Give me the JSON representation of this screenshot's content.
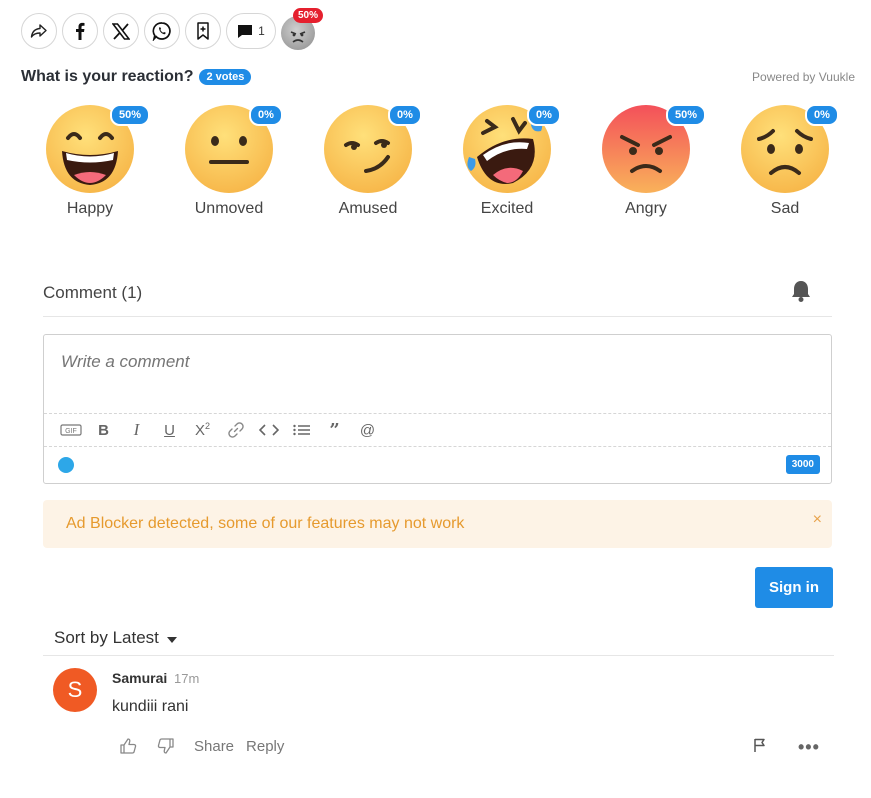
{
  "share_bar": {
    "comment_count": "1",
    "reaction_badge": "50%"
  },
  "reactions_widget": {
    "title": "What is your reaction?",
    "votes": "2 votes",
    "powered_by": "Powered by Vuukle",
    "items": [
      {
        "label": "Happy",
        "percent": "50%",
        "icon": "grinning-face-icon"
      },
      {
        "label": "Unmoved",
        "percent": "0%",
        "icon": "neutral-face-icon"
      },
      {
        "label": "Amused",
        "percent": "0%",
        "icon": "smirking-face-icon"
      },
      {
        "label": "Excited",
        "percent": "0%",
        "icon": "rolling-laughing-face-icon"
      },
      {
        "label": "Angry",
        "percent": "50%",
        "icon": "angry-face-icon"
      },
      {
        "label": "Sad",
        "percent": "0%",
        "icon": "worried-face-icon"
      }
    ]
  },
  "comments": {
    "header": "Comment (1)",
    "editor": {
      "placeholder": "Write a comment",
      "char_limit": "3000"
    },
    "adblock_notice": "Ad Blocker detected, some of our features may not work",
    "adblock_close": "×",
    "sign_in_label": "Sign in",
    "sort_label": "Sort by Latest",
    "list": [
      {
        "avatar_letter": "S",
        "author": "Samurai",
        "time": "17m",
        "text": "kundiii rani",
        "share_label": "Share",
        "reply_label": "Reply"
      }
    ]
  },
  "colors": {
    "accent": "#1f8ce6",
    "badge_red": "#e5202e",
    "avatar": "#f05a24",
    "adblock_bg": "#fdf3e6",
    "adblock_text": "#e69a2e"
  }
}
